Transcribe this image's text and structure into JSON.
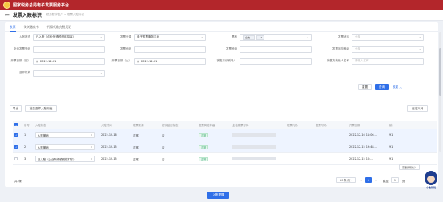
{
  "header": {
    "app_title": "国家税务总局电子发票服务平台"
  },
  "page": {
    "title": "发票入账标识",
    "breadcrumb": "税务数字账户 > 发票入账标识",
    "back_icon": "arrow-left-icon"
  },
  "tabs": [
    {
      "label": "发票",
      "active": true
    },
    {
      "label": "海关缴款书",
      "active": false
    },
    {
      "label": "代扣代缴完税凭证",
      "active": false
    }
  ],
  "filters": {
    "entry_status": {
      "label": "入账状态",
      "value": "已入账（企业所得税税前扣除）"
    },
    "invoice_source": {
      "label": "发票来源",
      "value": "电子发票服务平台"
    },
    "ticket_type": {
      "label": "票种",
      "chip": "全电...",
      "chip_extra": "+7"
    },
    "invoice_status": {
      "label": "发票状态",
      "placeholder": "全部"
    },
    "digital_invoice_no": {
      "label": "全电发票号码",
      "placeholder": ""
    },
    "invoice_code": {
      "label": "发票代码",
      "placeholder": ""
    },
    "invoice_no": {
      "label": "发票号码",
      "placeholder": ""
    },
    "risk_level": {
      "label": "发票风险等级",
      "placeholder": "全部"
    },
    "date_start": {
      "label": "开票日期（起）",
      "value": "2022-12-01"
    },
    "date_end": {
      "label": "开票日期（止）",
      "value": "2022-12-01"
    },
    "seller_id": {
      "label": "销售方识别号/...",
      "placeholder": ""
    },
    "seller_name": {
      "label": "销售方纳税人名称",
      "placeholder": "请输入名称"
    },
    "choose_org": {
      "label": "选择机构",
      "placeholder": ""
    }
  },
  "actions": {
    "reset": "重置",
    "query": "查询",
    "collapse": "收起",
    "export": "导出",
    "batch_entry": "批量选择入账用途",
    "column_config": "自定义列"
  },
  "table": {
    "headers": [
      "序号",
      "入账状态",
      "入账时间",
      "发票来源",
      "红字锁定标志",
      "发票风险等级",
      "全电发票号码",
      "发票代码",
      "发票号码",
      "开票日期",
      "销"
    ],
    "rows": [
      {
        "checked": true,
        "seq": "1",
        "status": "入账撤销",
        "time": "2022-12-16",
        "source": "正常",
        "red_lock": "否",
        "risk": "正常",
        "date": "2022-12-16 11:06...",
        "extra": "91"
      },
      {
        "checked": true,
        "seq": "2",
        "status": "入账撤销",
        "time": "2022-12-15",
        "source": "正常",
        "red_lock": "否",
        "risk": "正常",
        "date": "2022-12-15 19:48...",
        "extra": "91"
      },
      {
        "checked": false,
        "seq": "3",
        "status": "已入账（企业所得税税前扣除）",
        "time": "2022-12-15",
        "source": "正常",
        "red_lock": "否",
        "risk": "正常",
        "date": "2022-12-15 10:...",
        "extra": "91"
      }
    ]
  },
  "pagination": {
    "total": "共3条",
    "page_size": "10 条/页",
    "current": "1",
    "goto_prefix": "跳至",
    "goto_value": "1",
    "goto_suffix": "页"
  },
  "bottom_button": "入账提醒",
  "assistant": {
    "bubble": "需要我帮忙？",
    "caption": "小数税税"
  }
}
